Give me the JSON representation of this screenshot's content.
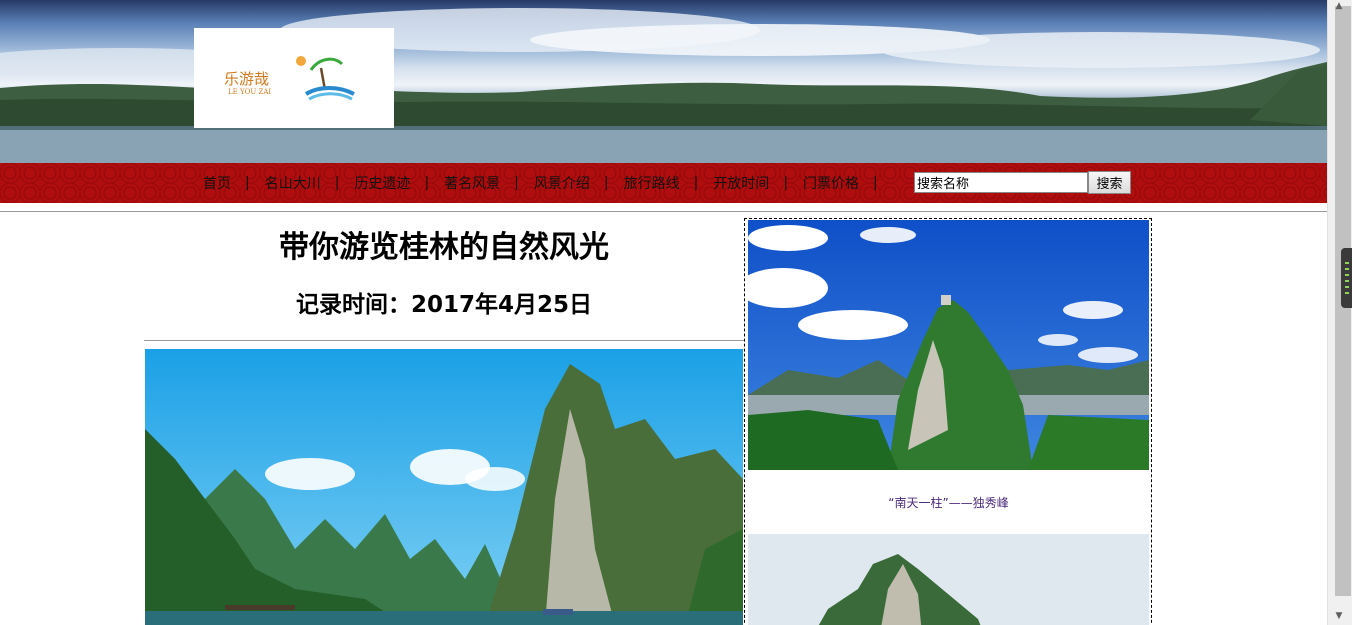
{
  "header": {
    "logo": {
      "text": "乐游哉",
      "subtext": "LE YOU ZAI"
    }
  },
  "nav": {
    "items": [
      {
        "label": "首页"
      },
      {
        "label": "名山大川"
      },
      {
        "label": "历史遗迹"
      },
      {
        "label": "著名风景"
      },
      {
        "label": "风景介绍"
      },
      {
        "label": "旅行路线"
      },
      {
        "label": "开放时间"
      },
      {
        "label": "门票价格"
      }
    ],
    "separator": "|",
    "search": {
      "value": "搜索名称",
      "button_label": "搜索"
    }
  },
  "article": {
    "title": "带你游览桂林的自然风光",
    "date": "记录时间：2017年4月25日"
  },
  "sidebar": {
    "items": [
      {
        "caption": "“南天一柱”——独秀峰"
      }
    ]
  },
  "colors": {
    "nav_bg": "#b00d0e",
    "caption": "#4b2a7a",
    "sidebar_border": "#000000"
  },
  "icons": {
    "scroll_up": "▲",
    "scroll_down": "▼"
  }
}
